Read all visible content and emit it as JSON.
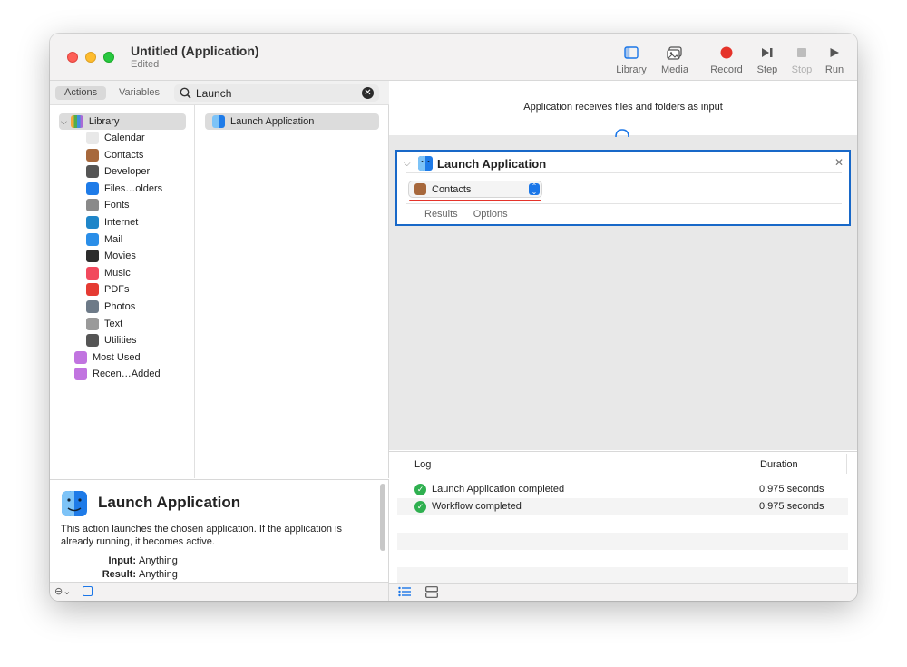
{
  "window": {
    "title": "Untitled (Application)",
    "subtitle": "Edited"
  },
  "toolbar": {
    "library": "Library",
    "media": "Media",
    "record": "Record",
    "step": "Step",
    "stop": "Stop",
    "run": "Run"
  },
  "left_panel": {
    "segments": {
      "actions": "Actions",
      "variables": "Variables"
    },
    "search": {
      "value": "Launch",
      "placeholder": ""
    },
    "library": {
      "root": "Library",
      "items": [
        {
          "label": "Calendar",
          "icon": "calendar-icon",
          "color": "#e8e8e8"
        },
        {
          "label": "Contacts",
          "icon": "contacts-icon",
          "color": "#a7683c"
        },
        {
          "label": "Developer",
          "icon": "tools-icon",
          "color": "#555555"
        },
        {
          "label": "Files…olders",
          "icon": "finder-icon",
          "color": "#1e7be8"
        },
        {
          "label": "Fonts",
          "icon": "fonts-icon",
          "color": "#8a8a8a"
        },
        {
          "label": "Internet",
          "icon": "globe-icon",
          "color": "#1f86c9"
        },
        {
          "label": "Mail",
          "icon": "mail-icon",
          "color": "#2a8ee8"
        },
        {
          "label": "Movies",
          "icon": "movies-icon",
          "color": "#2c2c2c"
        },
        {
          "label": "Music",
          "icon": "music-icon",
          "color": "#f2495d"
        },
        {
          "label": "PDFs",
          "icon": "pdf-icon",
          "color": "#e53b33"
        },
        {
          "label": "Photos",
          "icon": "photos-icon",
          "color": "#6d7a88"
        },
        {
          "label": "Text",
          "icon": "text-icon",
          "color": "#9a9a9a"
        },
        {
          "label": "Utilities",
          "icon": "utilities-icon",
          "color": "#555555"
        }
      ],
      "smart": [
        {
          "label": "Most Used",
          "icon": "smart-folder-icon",
          "color": "#c174e0"
        },
        {
          "label": "Recen…Added",
          "icon": "smart-folder-icon",
          "color": "#c174e0"
        }
      ]
    },
    "results": [
      {
        "label": "Launch Application",
        "icon": "finder-icon"
      }
    ]
  },
  "description": {
    "title": "Launch Application",
    "text": "This action launches the chosen application. If the application is already running, it becomes active.",
    "input_label": "Input:",
    "input_value": "Anything",
    "result_label": "Result:",
    "result_value": "Anything"
  },
  "workflow": {
    "input_text": "Application receives files and folders as input",
    "action": {
      "title": "Launch Application",
      "app_value": "Contacts",
      "tabs": {
        "results": "Results",
        "options": "Options"
      }
    }
  },
  "log": {
    "headers": {
      "log": "Log",
      "duration": "Duration"
    },
    "rows": [
      {
        "message": "Launch Application completed",
        "duration": "0.975 seconds"
      },
      {
        "message": "Workflow completed",
        "duration": "0.975 seconds"
      }
    ]
  },
  "colors": {
    "accent": "#1868c8",
    "record": "#e5332a",
    "success": "#2fb050"
  }
}
